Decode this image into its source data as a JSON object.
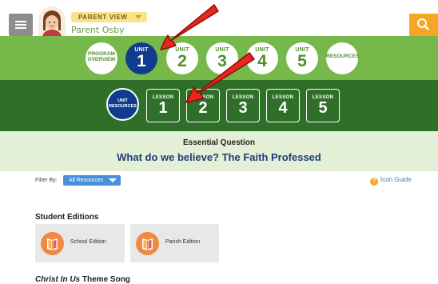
{
  "header": {
    "role": "PARENT VIEW",
    "user_name": "Parent Osby"
  },
  "units_nav": {
    "program_overview": "PROGRAM OVERVIEW",
    "units": [
      {
        "label": "UNIT",
        "number": "1",
        "active": true
      },
      {
        "label": "UNIT",
        "number": "2",
        "active": false
      },
      {
        "label": "UNIT",
        "number": "3",
        "active": false
      },
      {
        "label": "UNIT",
        "number": "4",
        "active": false
      },
      {
        "label": "UNIT",
        "number": "5",
        "active": false
      }
    ],
    "resources": "RESOURCES"
  },
  "lessons_nav": {
    "unit_resources": "UNIT RESOURCES",
    "lessons": [
      {
        "label": "LESSON",
        "number": "1"
      },
      {
        "label": "LESSON",
        "number": "2"
      },
      {
        "label": "LESSON",
        "number": "3"
      },
      {
        "label": "LESSON",
        "number": "4"
      },
      {
        "label": "LESSON",
        "number": "5"
      }
    ]
  },
  "essential_question": {
    "label": "Essential Question",
    "text": "What do we believe? The Faith Professed"
  },
  "filter": {
    "label": "Filter By:",
    "selected": "All Resources",
    "icon_guide": "Icon Guide"
  },
  "student_editions": {
    "title": "Student Editions",
    "cards": [
      {
        "label": "School Edition"
      },
      {
        "label": "Parish Edition"
      }
    ]
  },
  "theme_song": {
    "title_italic": "Christ In Us",
    "title_rest": "Theme Song"
  },
  "colors": {
    "units_band": "#76b84a",
    "lessons_band": "#2f6f2a",
    "active_unit": "#0f3c8c",
    "question_band": "#e3f0d6",
    "search_button": "#f5a623",
    "annotation_arrow": "#e8261c"
  }
}
